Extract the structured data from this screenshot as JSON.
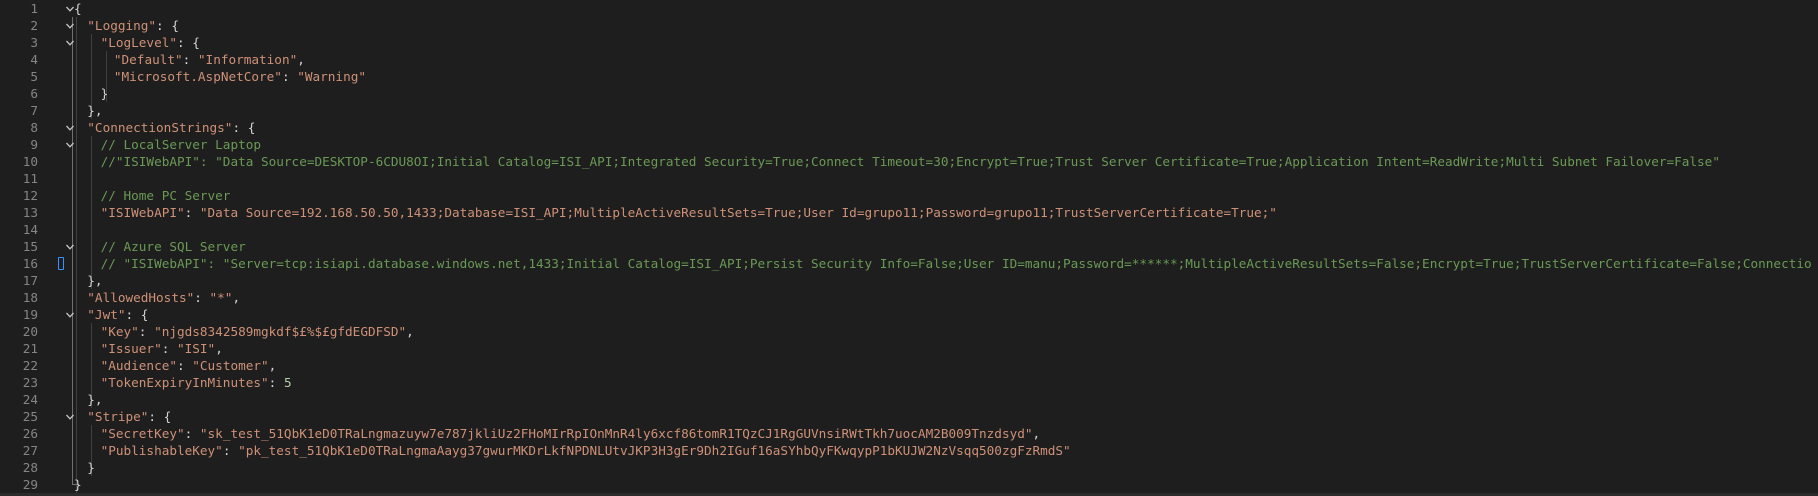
{
  "editor": {
    "lines": [
      {
        "n": "1",
        "indent": 0,
        "fold": true,
        "tokens": [
          {
            "t": "{",
            "c": "p"
          }
        ]
      },
      {
        "n": "2",
        "indent": 1,
        "fold": true,
        "tokens": [
          {
            "t": "\"Logging\"",
            "c": "key"
          },
          {
            "t": ": {",
            "c": "p"
          }
        ]
      },
      {
        "n": "3",
        "indent": 2,
        "fold": true,
        "tokens": [
          {
            "t": "\"LogLevel\"",
            "c": "key"
          },
          {
            "t": ": {",
            "c": "p"
          }
        ]
      },
      {
        "n": "4",
        "indent": 3,
        "fold": false,
        "tokens": [
          {
            "t": "\"Default\"",
            "c": "key"
          },
          {
            "t": ": ",
            "c": "p"
          },
          {
            "t": "\"Information\"",
            "c": "s"
          },
          {
            "t": ",",
            "c": "p"
          }
        ]
      },
      {
        "n": "5",
        "indent": 3,
        "fold": false,
        "tokens": [
          {
            "t": "\"Microsoft.AspNetCore\"",
            "c": "key"
          },
          {
            "t": ": ",
            "c": "p"
          },
          {
            "t": "\"Warning\"",
            "c": "s"
          }
        ]
      },
      {
        "n": "6",
        "indent": 2,
        "fold": false,
        "tokens": [
          {
            "t": "}",
            "c": "p"
          }
        ]
      },
      {
        "n": "7",
        "indent": 1,
        "fold": false,
        "tokens": [
          {
            "t": "},",
            "c": "p"
          }
        ]
      },
      {
        "n": "8",
        "indent": 1,
        "fold": true,
        "tokens": [
          {
            "t": "\"ConnectionStrings\"",
            "c": "key"
          },
          {
            "t": ": {",
            "c": "p"
          }
        ]
      },
      {
        "n": "9",
        "indent": 2,
        "fold": true,
        "tokens": [
          {
            "t": "// LocalServer Laptop",
            "c": "c"
          }
        ]
      },
      {
        "n": "10",
        "indent": 2,
        "fold": false,
        "tokens": [
          {
            "t": "//\"ISIWebAPI\": \"Data Source=DESKTOP-6CDU8OI;Initial Catalog=ISI_API;Integrated Security=True;Connect Timeout=30;Encrypt=True;Trust Server Certificate=True;Application Intent=ReadWrite;Multi Subnet Failover=False\"",
            "c": "c"
          }
        ]
      },
      {
        "n": "11",
        "indent": 0,
        "fold": false,
        "tokens": []
      },
      {
        "n": "12",
        "indent": 2,
        "fold": false,
        "tokens": [
          {
            "t": "// Home PC Server",
            "c": "c"
          }
        ]
      },
      {
        "n": "13",
        "indent": 2,
        "fold": false,
        "tokens": [
          {
            "t": "\"ISIWebAPI\"",
            "c": "key"
          },
          {
            "t": ": ",
            "c": "p"
          },
          {
            "t": "\"Data Source=192.168.50.50,1433;Database=ISI_API;MultipleActiveResultSets=True;User Id=grupo11;Password=grupo11;TrustServerCertificate=True;\"",
            "c": "s"
          }
        ]
      },
      {
        "n": "14",
        "indent": 0,
        "fold": false,
        "tokens": []
      },
      {
        "n": "15",
        "indent": 2,
        "fold": true,
        "tokens": [
          {
            "t": "// Azure SQL Server",
            "c": "c"
          }
        ]
      },
      {
        "n": "16",
        "indent": 2,
        "fold": false,
        "marker": true,
        "tokens": [
          {
            "t": "// \"ISIWebAPI\": \"Server=tcp:isiapi.database.windows.net,1433;Initial Catalog=ISI_API;Persist Security Info=False;User ID=manu;Password=******;MultipleActiveResultSets=False;Encrypt=True;TrustServerCertificate=False;Connectio",
            "c": "c"
          }
        ]
      },
      {
        "n": "17",
        "indent": 1,
        "fold": false,
        "tokens": [
          {
            "t": "},",
            "c": "p"
          }
        ]
      },
      {
        "n": "18",
        "indent": 1,
        "fold": false,
        "tokens": [
          {
            "t": "\"AllowedHosts\"",
            "c": "key"
          },
          {
            "t": ": ",
            "c": "p"
          },
          {
            "t": "\"*\"",
            "c": "s"
          },
          {
            "t": ",",
            "c": "p"
          }
        ]
      },
      {
        "n": "19",
        "indent": 1,
        "fold": true,
        "tokens": [
          {
            "t": "\"Jwt\"",
            "c": "key"
          },
          {
            "t": ": {",
            "c": "p"
          }
        ]
      },
      {
        "n": "20",
        "indent": 2,
        "fold": false,
        "tokens": [
          {
            "t": "\"Key\"",
            "c": "key"
          },
          {
            "t": ": ",
            "c": "p"
          },
          {
            "t": "\"njgds8342589mgkdf$£%$£gfdEGDFSD\"",
            "c": "s"
          },
          {
            "t": ",",
            "c": "p"
          }
        ]
      },
      {
        "n": "21",
        "indent": 2,
        "fold": false,
        "tokens": [
          {
            "t": "\"Issuer\"",
            "c": "key"
          },
          {
            "t": ": ",
            "c": "p"
          },
          {
            "t": "\"ISI\"",
            "c": "s"
          },
          {
            "t": ",",
            "c": "p"
          }
        ]
      },
      {
        "n": "22",
        "indent": 2,
        "fold": false,
        "tokens": [
          {
            "t": "\"Audience\"",
            "c": "key"
          },
          {
            "t": ": ",
            "c": "p"
          },
          {
            "t": "\"Customer\"",
            "c": "s"
          },
          {
            "t": ",",
            "c": "p"
          }
        ]
      },
      {
        "n": "23",
        "indent": 2,
        "fold": false,
        "tokens": [
          {
            "t": "\"TokenExpiryInMinutes\"",
            "c": "key"
          },
          {
            "t": ": ",
            "c": "p"
          },
          {
            "t": "5",
            "c": "n"
          }
        ]
      },
      {
        "n": "24",
        "indent": 1,
        "fold": false,
        "tokens": [
          {
            "t": "},",
            "c": "p"
          }
        ]
      },
      {
        "n": "25",
        "indent": 1,
        "fold": true,
        "tokens": [
          {
            "t": "\"Stripe\"",
            "c": "key"
          },
          {
            "t": ": {",
            "c": "p"
          }
        ]
      },
      {
        "n": "26",
        "indent": 2,
        "fold": false,
        "tokens": [
          {
            "t": "\"SecretKey\"",
            "c": "key"
          },
          {
            "t": ": ",
            "c": "p"
          },
          {
            "t": "\"sk_test_51QbK1eD0TRaLngmazuyw7e787jkliUz2FHoMIrRpIOnMnR4ly6xcf86tomR1TQzCJ1RgGUVnsiRWtTkh7uocAM2B009Tnzdsyd\"",
            "c": "s"
          },
          {
            "t": ",",
            "c": "p"
          }
        ]
      },
      {
        "n": "27",
        "indent": 2,
        "fold": false,
        "tokens": [
          {
            "t": "\"PublishableKey\"",
            "c": "key"
          },
          {
            "t": ": ",
            "c": "p"
          },
          {
            "t": "\"pk_test_51QbK1eD0TRaLngmaAayg37gwurMKDrLkfNPDNLUtvJKP3H3gEr9Dh2IGuf16aSYhbQyFKwqypP1bKUJW2NzVsqq500zgFzRmdS\"",
            "c": "s"
          }
        ]
      },
      {
        "n": "28",
        "indent": 1,
        "fold": false,
        "tokens": [
          {
            "t": "}",
            "c": "p"
          }
        ]
      },
      {
        "n": "29",
        "indent": 0,
        "fold": false,
        "tokens": [
          {
            "t": "}",
            "c": "p"
          }
        ]
      }
    ]
  },
  "colors": {
    "background": "#1e1e1e",
    "line_number": "#858585",
    "key": "#ce9178",
    "string": "#ce9178",
    "number": "#b5cea8",
    "comment": "#6a9955",
    "punctuation": "#d4d4d4"
  },
  "icons": {
    "fold": "chevron-down-icon",
    "marker": "glyph-margin-marker-icon"
  }
}
